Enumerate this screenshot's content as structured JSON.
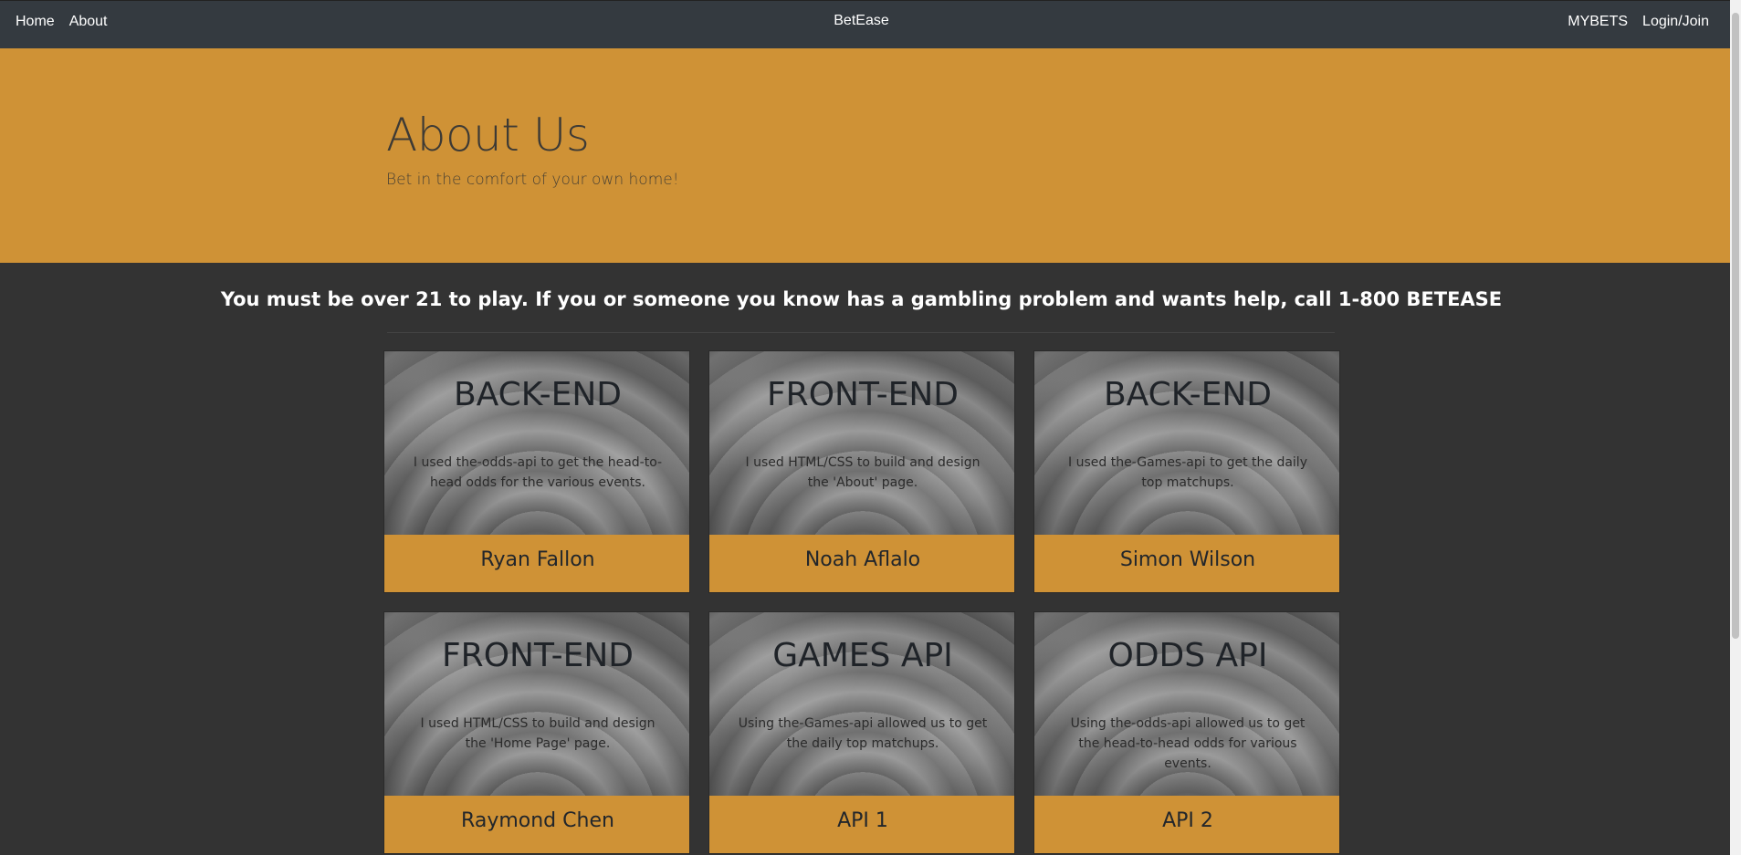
{
  "nav": {
    "left": [
      "Home",
      "About"
    ],
    "brand": "BetEase",
    "right": [
      "MYBETS",
      "Login/Join"
    ]
  },
  "hero": {
    "title": "About Us",
    "subtitle": "Bet in the comfort of your own home!"
  },
  "warning": "You must be over 21 to play. If you or someone you know has a gambling problem and wants help, call 1-800 BETEASE",
  "cards": [
    {
      "title": "BACK-END",
      "text": "I used the-odds-api to get the head-to-head odds for the various events.",
      "name": "Ryan Fallon"
    },
    {
      "title": "FRONT-END",
      "text": "I used HTML/CSS to build and design the 'About' page.",
      "name": "Noah Aflalo"
    },
    {
      "title": "BACK-END",
      "text": "I used the-Games-api to get the daily top matchups.",
      "name": "Simon Wilson"
    },
    {
      "title": "FRONT-END",
      "text": "I used HTML/CSS to build and design the 'Home Page' page.",
      "name": "Raymond Chen"
    },
    {
      "title": "GAMES API",
      "text": "Using the-Games-api allowed us to get the daily top matchups.",
      "name": "API 1"
    },
    {
      "title": "ODDS API",
      "text": "Using the-odds-api allowed us to get the head-to-head odds for various events.",
      "name": "API 2"
    }
  ],
  "colors": {
    "accent": "#cf9236",
    "navbar": "#343a40",
    "background": "#333333"
  }
}
